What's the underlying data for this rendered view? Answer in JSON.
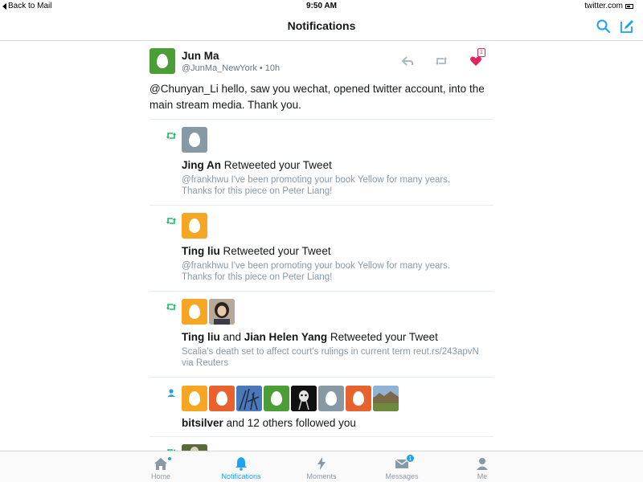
{
  "statusbar": {
    "back_label": "Back to Mail",
    "time": "9:50 AM",
    "right_label": "twitter.com"
  },
  "navbar": {
    "title": "Notifications",
    "search_icon": "search-icon",
    "compose_icon": "compose-tweet-icon",
    "accent": "#1da1f2"
  },
  "tweet": {
    "author_name": "Jun Ma",
    "author_handle": "@JunMa_NewYork",
    "separator": "•",
    "time": "10h",
    "text": "@Chunyan_Li hello, saw you wechat, opened twitter account, into the main stream media. Thank you.",
    "like_count": "1",
    "avatar_color": "#4a9e35",
    "like_color": "#e0245e",
    "actions": [
      "reply-icon",
      "retweet-icon",
      "like-heart-icon"
    ]
  },
  "notifications": [
    {
      "type": "retweet",
      "user": "Jing An",
      "action_text": " Retweeted your Tweet",
      "snippet": "@frankhwu I've been promoting your book Yellow for many years. Thanks for this piece on Peter Liang!",
      "avatar_colors": [
        "#8899a6"
      ]
    },
    {
      "type": "retweet",
      "user": "Ting liu",
      "action_text": " Retweeted your Tweet",
      "snippet": "@frankhwu I've been promoting your book Yellow for many years. Thanks for this piece on Peter Liang!",
      "avatar_colors": [
        "#f5a623"
      ]
    },
    {
      "type": "retweet",
      "user": "Ting liu",
      "joiner": " and ",
      "user2": "Jian Helen Yang",
      "action_text": " Retweeted your Tweet",
      "snippet": "Scalia's death set to affect court's rulings in current term reut.rs/243apvN via Reuters",
      "avatar_colors": [
        "#f5a623",
        "photo"
      ]
    },
    {
      "type": "follow",
      "user": "bitsilver",
      "action_text": " and 12 others followed you",
      "avatar_colors": [
        "#f5a623",
        "#e8622d",
        "photo-blue",
        "#4a9e35",
        "photo-dark",
        "#8899a6",
        "#e8622d",
        "photo-field"
      ]
    }
  ],
  "colors": {
    "retweet_green": "#17bf63",
    "follow_blue": "#1da1f2",
    "muted": "#8899a6"
  },
  "tabbar": {
    "items": [
      {
        "label": "Home",
        "icon": "home-icon"
      },
      {
        "label": "Notifications",
        "icon": "bell-icon"
      },
      {
        "label": "Moments",
        "icon": "lightning-icon"
      },
      {
        "label": "Messages",
        "icon": "envelope-icon",
        "badge": "1"
      },
      {
        "label": "Me",
        "icon": "person-icon"
      }
    ],
    "active": "Notifications"
  }
}
